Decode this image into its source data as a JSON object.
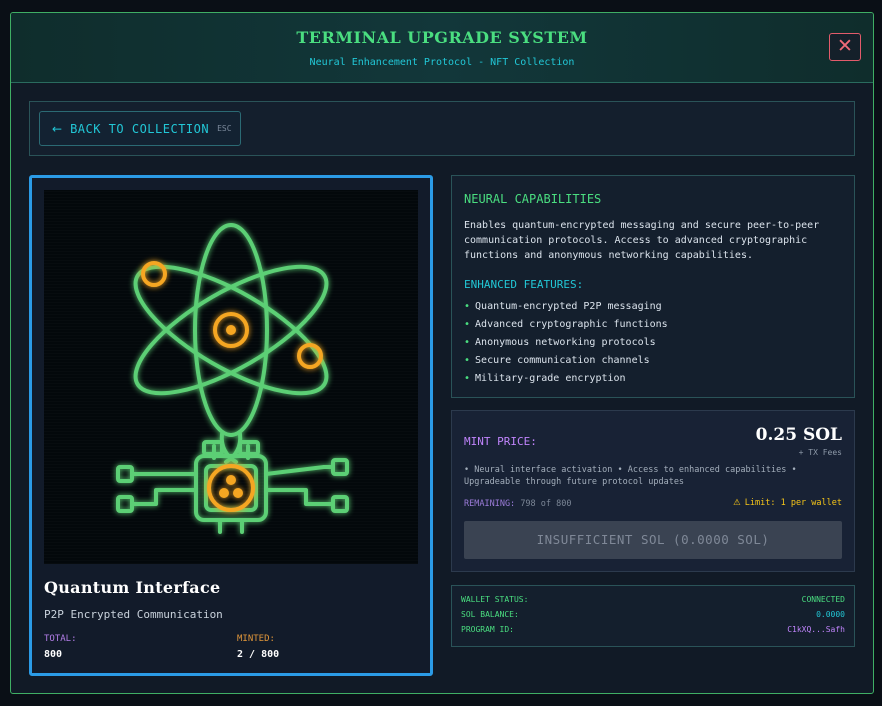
{
  "header": {
    "title": "TERMINAL UPGRADE SYSTEM",
    "subtitle": "Neural Enhancement Protocol - NFT Collection",
    "close_icon": "close-icon"
  },
  "nav": {
    "back_label": "BACK TO COLLECTION",
    "back_shortcut": "ESC",
    "back_icon": "arrow-left-icon"
  },
  "nft": {
    "name": "Quantum Interface",
    "description": "P2P Encrypted Communication",
    "total_label": "TOTAL:",
    "total_value": "800",
    "minted_label": "MINTED:",
    "minted_value": "2 / 800",
    "art_icon": "atom-chip-icon"
  },
  "capabilities": {
    "title": "NEURAL CAPABILITIES",
    "body": "Enables quantum-encrypted messaging and secure peer-to-peer communication protocols. Access to advanced cryptographic functions and anonymous networking capabilities.",
    "features_title": "ENHANCED FEATURES:",
    "features": [
      "Quantum-encrypted P2P messaging",
      "Advanced cryptographic functions",
      "Anonymous networking protocols",
      "Secure communication channels",
      "Military-grade encryption"
    ]
  },
  "mint": {
    "label": "MINT PRICE:",
    "price": "0.25 SOL",
    "fees": "+ TX Fees",
    "bullets": "• Neural interface activation • Access to enhanced capabilities • Upgradeable through future protocol updates",
    "remaining_label": "REMAINING:",
    "remaining_value": "798 of 800",
    "limit": "Limit: 1 per wallet",
    "button_label": "INSUFFICIENT SOL (0.0000 SOL)"
  },
  "wallet": {
    "status_label": "WALLET STATUS:",
    "status_value": "CONNECTED",
    "balance_label": "SOL BALANCE:",
    "balance_value": "0.0000",
    "program_label": "PROGRAM ID:",
    "program_value": "C1kXQ...Safh"
  },
  "colors": {
    "accent_green": "#4ade80",
    "accent_cyan": "#22c7d6",
    "accent_purple": "#c084fc",
    "card_border": "#2b9be6",
    "art_orange": "#f5a623",
    "close_red": "#e25b6b"
  }
}
